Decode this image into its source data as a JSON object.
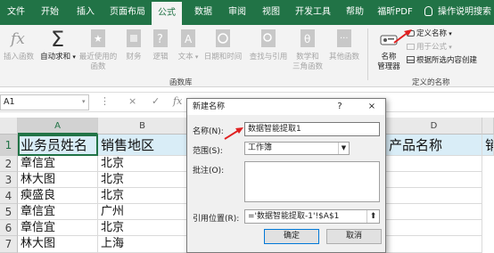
{
  "ribbon_tabs": {
    "file": "文件",
    "home": "开始",
    "insert": "插入",
    "page_layout": "页面布局",
    "formulas": "公式",
    "data": "数据",
    "review": "审阅",
    "view": "视图",
    "developer": "开发工具",
    "help": "帮助",
    "foxit_pdf": "福昕PDF",
    "tell_me": "操作说明搜索"
  },
  "ribbon": {
    "insert_function": "插入函数",
    "autosum": "自动求和",
    "recently_used": "最近使用的",
    "recently_used_2": "函数",
    "financial": "财务",
    "logical": "逻辑",
    "text": "文本",
    "date_time": "日期和时间",
    "lookup_ref": "查找与引用",
    "math_trig": "数学和",
    "math_trig_2": "三角函数",
    "more_functions": "其他函数",
    "function_library": "函数库",
    "name_manager": "名称",
    "name_manager_2": "管理器",
    "define_name": "定义名称",
    "use_in_formula": "用于公式",
    "create_from_selection": "根据所选内容创建",
    "defined_names": "定义的名称"
  },
  "formula_bar": {
    "name_box": "A1",
    "cancel": "×",
    "enter": "✓",
    "fx": "fx"
  },
  "columns": {
    "A": "A",
    "B": "B",
    "D": "D"
  },
  "rows": [
    "1",
    "2",
    "3",
    "4",
    "5",
    "6",
    "7"
  ],
  "sheet": {
    "headers": {
      "a1": "业务员姓名",
      "b1": "销售地区",
      "d1": "产品名称",
      "e1": "销"
    },
    "col_a": [
      "章信宜",
      "林大图",
      "瘐盛良",
      "章信宜",
      "章信宜",
      "林大图"
    ],
    "col_b": [
      "北京",
      "北京",
      "北京",
      "广州",
      "北京",
      "上海"
    ]
  },
  "dialog": {
    "title": "新建名称",
    "help": "?",
    "close": "×",
    "name_label": "名称(N):",
    "name_value": "数据智能提取1",
    "scope_label": "范围(S):",
    "scope_value": "工作簿",
    "comment_label": "批注(O):",
    "refers_label": "引用位置(R):",
    "refers_value": "='数据智能提取-1'!$A$1",
    "ok": "确定",
    "cancel": "取消"
  },
  "colors": {
    "excel_green": "#217346",
    "header_fill": "#d9edf7",
    "annotation_red": "#e02020"
  }
}
